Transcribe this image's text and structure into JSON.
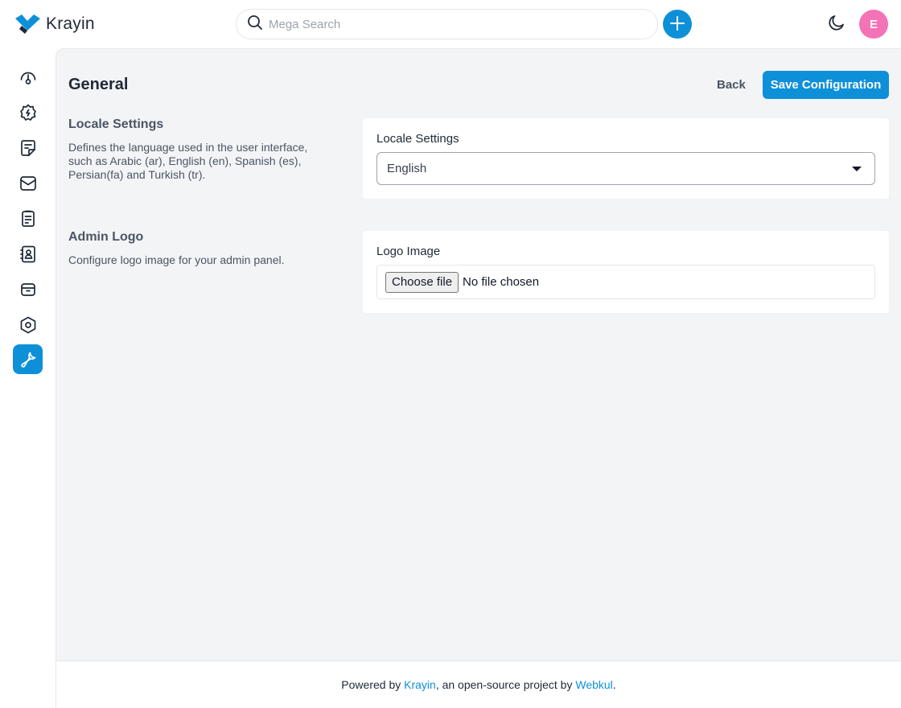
{
  "brand": {
    "name": "Krayin",
    "logo_icon": "krayin-logo-icon",
    "colors": {
      "logo_blue": "#0e90d9",
      "logo_dark": "#1f2937"
    }
  },
  "header": {
    "search": {
      "placeholder": "Mega Search",
      "value": "",
      "icon": "search-icon"
    },
    "quick_add_icon": "plus-icon",
    "theme_icon": "moon-icon",
    "avatar_initial": "E",
    "colors": {
      "accent": "#0e90d9",
      "avatar": "#f472b6"
    }
  },
  "sidebar": {
    "items": [
      {
        "name": "dashboard",
        "icon": "dashboard-gauge-icon",
        "active": false
      },
      {
        "name": "leads",
        "icon": "leads-icon",
        "active": false
      },
      {
        "name": "quotes",
        "icon": "quotes-icon",
        "active": false
      },
      {
        "name": "mail",
        "icon": "mail-icon",
        "active": false
      },
      {
        "name": "activities",
        "icon": "activities-icon",
        "active": false
      },
      {
        "name": "contacts",
        "icon": "contacts-icon",
        "active": false
      },
      {
        "name": "products",
        "icon": "products-icon",
        "active": false
      },
      {
        "name": "settings",
        "icon": "settings-icon",
        "active": false
      },
      {
        "name": "configuration",
        "icon": "wrench-icon",
        "active": true
      }
    ]
  },
  "page": {
    "title": "General",
    "back_label": "Back",
    "save_label": "Save Configuration"
  },
  "sections": {
    "locale": {
      "title": "Locale Settings",
      "description": "Defines the language used in the user interface, such as Arabic (ar), English (en), Spanish (es), Persian(fa) and Turkish (tr).",
      "field_label": "Locale Settings",
      "selected_value": "English"
    },
    "admin_logo": {
      "title": "Admin Logo",
      "description": "Configure logo image for your admin panel.",
      "field_label": "Logo Image",
      "file_button_label": "Choose file",
      "file_status": "No file chosen"
    }
  },
  "footer": {
    "prefix": "Powered by ",
    "krayin_link": "Krayin",
    "middle": ", an open-source project by ",
    "webkul_link": "Webkul",
    "suffix": "."
  }
}
